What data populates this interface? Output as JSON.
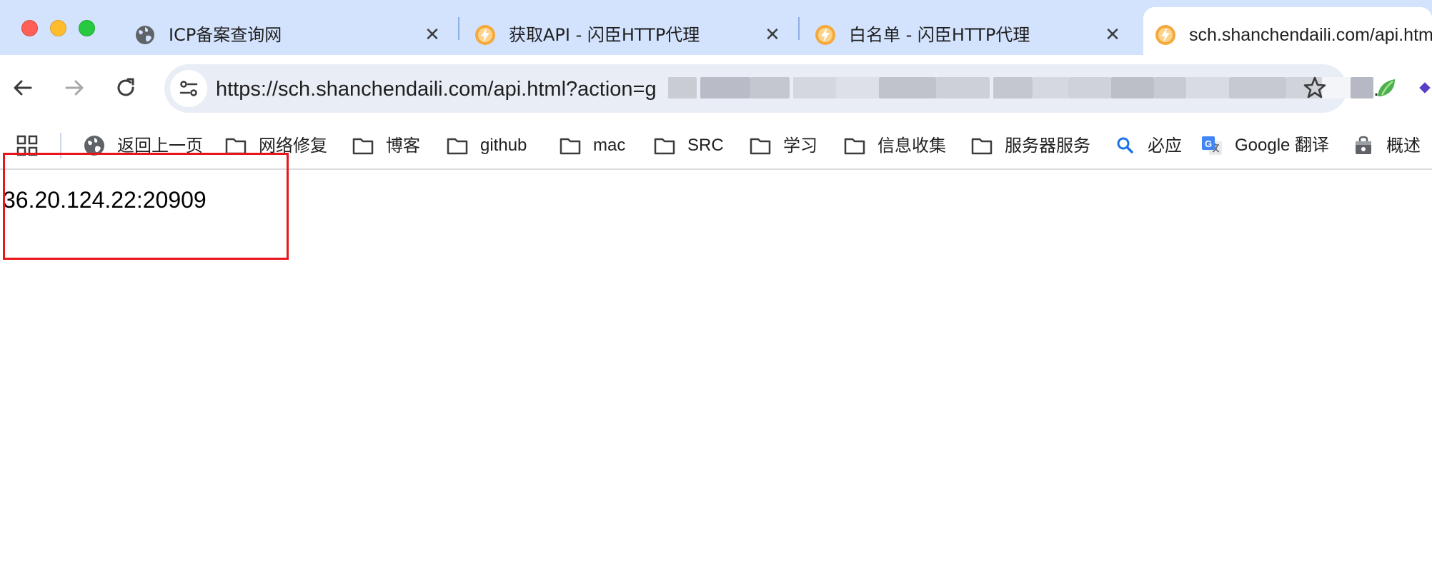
{
  "window": {
    "controls": [
      "close",
      "minimize",
      "maximize"
    ]
  },
  "tabs": [
    {
      "title": "ICP备案查询网",
      "icon": "globe-icon",
      "active": false
    },
    {
      "title": "获取API - 闪臣HTTP代理",
      "icon": "bolt-icon",
      "active": false
    },
    {
      "title": "白名单 - 闪臣HTTP代理",
      "icon": "bolt-icon",
      "active": false
    },
    {
      "title": "sch.shanchendaili.com/api.html",
      "icon": "bolt-icon",
      "active": true
    }
  ],
  "toolbar": {
    "url_visible": "https://sch.shanchendaili.com/api.html?action=g",
    "url_tail": "."
  },
  "bookmarks": [
    {
      "label": "返回上一页",
      "icon": "globe-icon"
    },
    {
      "label": "网络修复",
      "icon": "folder-icon"
    },
    {
      "label": "博客",
      "icon": "folder-icon"
    },
    {
      "label": "github",
      "icon": "folder-icon"
    },
    {
      "label": "mac",
      "icon": "folder-icon"
    },
    {
      "label": "SRC",
      "icon": "folder-icon"
    },
    {
      "label": "学习",
      "icon": "folder-icon"
    },
    {
      "label": "信息收集",
      "icon": "folder-icon"
    },
    {
      "label": "服务器服务",
      "icon": "folder-icon"
    },
    {
      "label": "必应",
      "icon": "search-icon"
    },
    {
      "label": "Google 翻译",
      "icon": "google-translate-icon"
    },
    {
      "label": "概述",
      "icon": "bag-icon"
    }
  ],
  "content": {
    "proxy_address": "36.20.124.22:20909"
  },
  "colors": {
    "tabstrip_bg": "#d3e3fd",
    "omnibox_bg": "#e9eef6",
    "highlight_border": "#e8151b"
  }
}
